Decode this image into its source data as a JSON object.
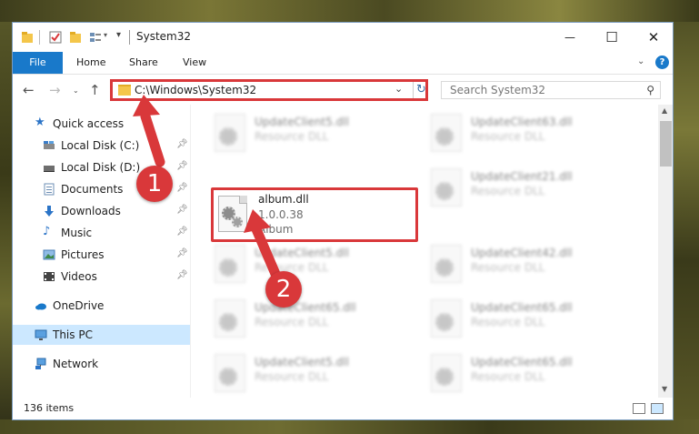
{
  "window": {
    "title": "System32",
    "minimize_glyph": "—",
    "maximize_glyph": "☐",
    "close_glyph": "✕"
  },
  "ribbon": {
    "file": "File",
    "tabs": [
      "Home",
      "Share",
      "View"
    ],
    "help": "?"
  },
  "address": {
    "path": "C:\\Windows\\System32",
    "search_placeholder": "Search System32"
  },
  "nav": {
    "quick_access": "Quick access",
    "items": [
      {
        "label": "Local Disk (C:)",
        "icon": "drive-icon",
        "pinned": true
      },
      {
        "label": "Local Disk (D:)",
        "icon": "drive-icon",
        "pinned": true
      },
      {
        "label": "Documents",
        "icon": "documents-icon",
        "pinned": true
      },
      {
        "label": "Downloads",
        "icon": "downloads-icon",
        "pinned": true
      },
      {
        "label": "Music",
        "icon": "music-icon",
        "pinned": true
      },
      {
        "label": "Pictures",
        "icon": "pictures-icon",
        "pinned": true
      },
      {
        "label": "Videos",
        "icon": "videos-icon",
        "pinned": true
      }
    ],
    "onedrive": "OneDrive",
    "this_pc": "This PC",
    "network": "Network"
  },
  "files": {
    "left": [
      {
        "name": "UpdateClient5.dll",
        "type": "Resource DLL"
      },
      {
        "name": "UpdateClient5.dll",
        "type": "Resource DLL"
      },
      {
        "name": "UpdateClient65.dll",
        "type": "Resource DLL"
      },
      {
        "name": "UpdateClient5.dll",
        "type": "Resource DLL"
      }
    ],
    "right": [
      {
        "name": "UpdateClient63.dll",
        "type": "Resource DLL"
      },
      {
        "name": "UpdateClient21.dll",
        "type": "Resource DLL"
      },
      {
        "name": "UpdateClient42.dll",
        "type": "Resource DLL"
      },
      {
        "name": "UpdateClient65.dll",
        "type": "Resource DLL"
      },
      {
        "name": "UpdateClient65.dll",
        "type": "Resource DLL"
      }
    ],
    "selected": {
      "name": "album.dll",
      "version": "1.0.0.38",
      "description": "Album"
    }
  },
  "status": {
    "count": "136 items"
  },
  "markers": [
    "1",
    "2"
  ],
  "colors": {
    "accent": "#1979ca",
    "highlight": "#d9383a",
    "selected_nav": "#cce8ff"
  }
}
